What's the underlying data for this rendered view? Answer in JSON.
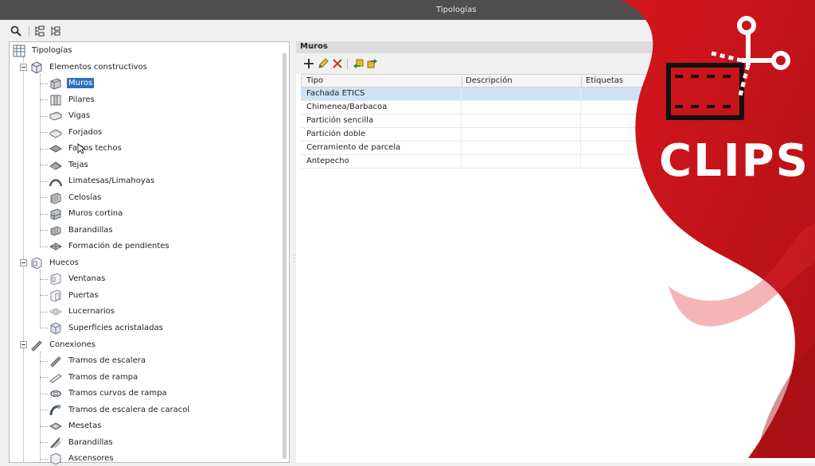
{
  "window": {
    "title": "Tipologías"
  },
  "tree": {
    "root_label": "Tipologías",
    "groups": [
      {
        "label": "Elementos constructivos",
        "items": [
          "Muros",
          "Pilares",
          "Vigas",
          "Forjados",
          "Falsos techos",
          "Tejas",
          "Limatesas/Limahoyas",
          "Celosías",
          "Muros cortina",
          "Barandillas",
          "Formación de pendientes"
        ]
      },
      {
        "label": "Huecos",
        "items": [
          "Ventanas",
          "Puertas",
          "Lucernarios",
          "Superficies acristaladas"
        ]
      },
      {
        "label": "Conexiones",
        "items": [
          "Tramos de escalera",
          "Tramos de rampa",
          "Tramos curvos de rampa",
          "Tramos de escalera de caracol",
          "Mesetas",
          "Barandillas",
          "Ascensores"
        ]
      }
    ],
    "selected_item": "Muros"
  },
  "panel": {
    "title": "Muros",
    "columns": [
      "Tipo",
      "Descripción",
      "Etiquetas"
    ],
    "rows": [
      "Fachada ETICS",
      "Chimenea/Barbacoa",
      "Partición sencilla",
      "Partición doble",
      "Cerramiento de parcela",
      "Antepecho"
    ],
    "selected_row": "Fachada ETICS"
  },
  "overlay": {
    "label": "CLIPS",
    "brand_color": "#c8141b",
    "icon": "film-scissors-icon"
  }
}
